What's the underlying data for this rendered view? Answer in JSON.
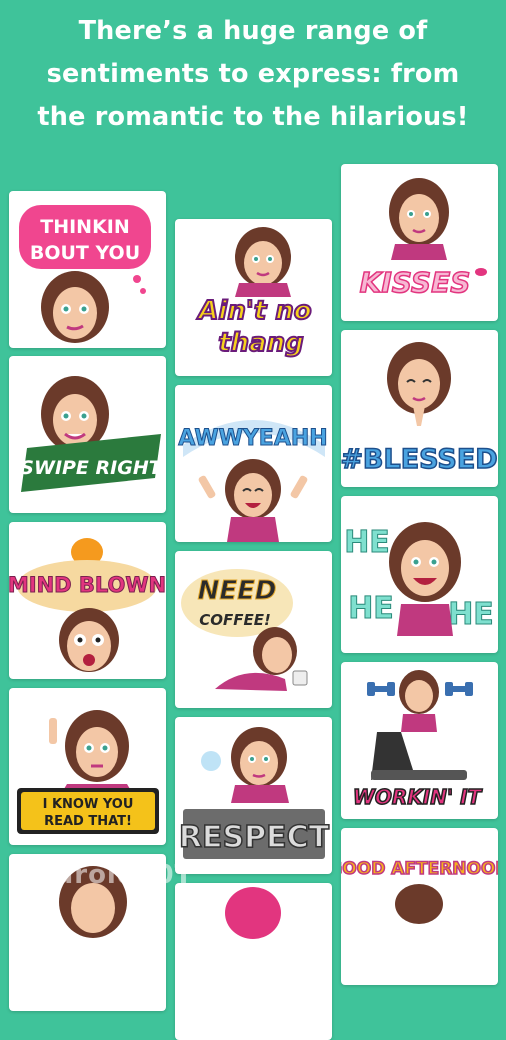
{
  "headline": {
    "line1": "There’s a huge range of",
    "line2": "sentiments to express: from",
    "line3": "the romantic to the hilarious!"
  },
  "stickers": [
    {
      "label": "THINKIN BOUT YOU",
      "l1": "THINKIN",
      "l2": "BOUT YOU"
    },
    {
      "label": "Ain't no thang",
      "l1": "Ain't no",
      "l2": "thang"
    },
    {
      "label": "KISSES",
      "l1": "KISSES"
    },
    {
      "label": "SWIPE RIGHT",
      "l1": "SWIPE RIGHT"
    },
    {
      "label": "AWWYEAHH",
      "l1": "AWWYEAHH"
    },
    {
      "label": "#BLESSED",
      "l1": "#BLESSED"
    },
    {
      "label": "MIND BLOWN",
      "l1": "MIND BLOWN"
    },
    {
      "label": "NEED COFFEE!",
      "l1": "NEED",
      "l2": "COFFEE!"
    },
    {
      "label": "HE HE HE",
      "l1": "HE",
      "l2": "HE",
      "l3": "HE"
    },
    {
      "label": "I KNOW YOU READ THAT!",
      "l1": "I KNOW YOU",
      "l2": "READ THAT!"
    },
    {
      "label": "RESPECT",
      "l1": "RESPECT"
    },
    {
      "label": "WORKIN' IT",
      "l1": "WORKIN' IT"
    },
    {
      "label": "GOOD AFTERNOON",
      "l1": "GOOD AFTERNOON"
    }
  ],
  "watermark": "Android30T",
  "colors": {
    "background": "#3fc39a",
    "card": "#ffffff",
    "hair": "#6b3a2a",
    "skin": "#f3c7a6",
    "top": "#c0397f"
  }
}
